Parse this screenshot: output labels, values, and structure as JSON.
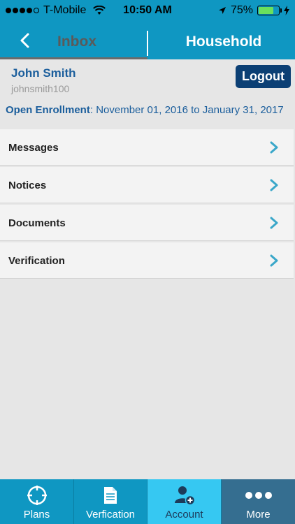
{
  "status_bar": {
    "carrier": "T-Mobile",
    "time": "10:50 AM",
    "battery_percent": "75%",
    "battery_level": 0.75
  },
  "nav": {
    "back_tab": "Inbox",
    "current_tab": "Household"
  },
  "user": {
    "name": "John Smith",
    "username": "johnsmith100",
    "logout_label": "Logout"
  },
  "enrollment": {
    "label": "Open Enrollment",
    "separator": ": ",
    "period": "November 01, 2016 to January 31, 2017"
  },
  "menu": {
    "items": [
      {
        "label": "Messages"
      },
      {
        "label": "Notices"
      },
      {
        "label": "Documents"
      },
      {
        "label": "Verification"
      }
    ]
  },
  "tabbar": {
    "items": [
      {
        "label": "Plans",
        "icon": "crosshair-icon"
      },
      {
        "label": "Verfication",
        "icon": "document-icon"
      },
      {
        "label": "Account",
        "icon": "add-user-icon"
      },
      {
        "label": "More",
        "icon": "more-dots-icon"
      }
    ]
  },
  "colors": {
    "primary": "#0f97c2",
    "dark_blue": "#0b3f74",
    "text_blue": "#1b5e9c",
    "active_tab": "#36c8f2",
    "more_tab": "#356e90",
    "chevron": "#3aa7c9"
  }
}
